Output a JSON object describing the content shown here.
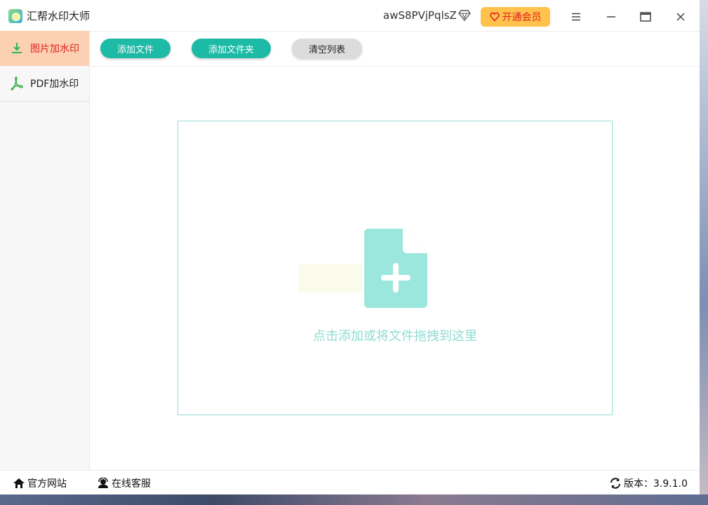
{
  "window": {
    "title": "汇帮水印大师",
    "username": "awS8PVjPqlsZ",
    "vip_label": "开通会员",
    "icons": [
      "app-logo",
      "diamond-icon",
      "heart-icon",
      "menu-icon",
      "minimize-icon",
      "maximize-icon",
      "close-icon"
    ]
  },
  "sidebar": {
    "items": [
      {
        "label": "图片加水印",
        "icon": "download-icon",
        "active": true
      },
      {
        "label": "PDF加水印",
        "icon": "pdf-icon",
        "active": false
      }
    ]
  },
  "toolbar": {
    "add_file": "添加文件",
    "add_folder": "添加文件夹",
    "clear_list": "清空列表"
  },
  "dropzone": {
    "hint": "点击添加或将文件拖拽到这里",
    "icon": "add-file-icon"
  },
  "footer": {
    "website": "官方网站",
    "support": "在线客服",
    "version_label": "版本：3.9.1.0"
  },
  "colors": {
    "accent": "#1dbaa6",
    "active_tab_bg": "#fcd1b3",
    "active_tab_text": "#e02020",
    "vip_bg": "#ffc24d",
    "drop_border": "#93e0d7",
    "drop_hint": "#8edcd2"
  }
}
